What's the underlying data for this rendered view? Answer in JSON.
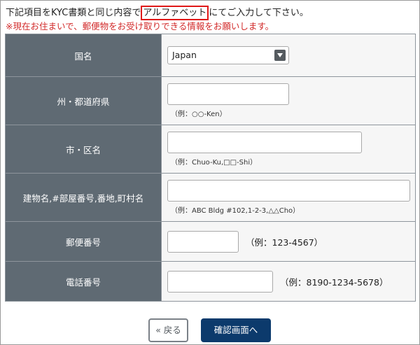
{
  "intro": {
    "line1_before": "下記項目をKYC書類と同じ内容で",
    "line1_highlight": "アルファベット",
    "line1_after": "にてご入力して下さい。",
    "line2": "※現在お住まいで、郵便物をお受け取りできる情報をお願いします。"
  },
  "form": {
    "country": {
      "label": "国名",
      "selected": "Japan"
    },
    "state": {
      "label": "州・都道府県",
      "value": "",
      "hint": "（例：○○-Ken）"
    },
    "city": {
      "label": "市・区名",
      "value": "",
      "hint": "（例：Chuo-Ku,□□-Shi）"
    },
    "address": {
      "label": "建物名,#部屋番号,番地,町村名",
      "value": "",
      "hint": "（例：ABC Bldg #102,1-2-3,△△Cho）"
    },
    "zip": {
      "label": "郵便番号",
      "value": "",
      "hint": "（例：123-4567）"
    },
    "tel": {
      "label": "電話番号",
      "value": "",
      "hint": "（例：8190-1234-5678）"
    }
  },
  "buttons": {
    "back": "« 戻る",
    "next": "確認画面へ"
  },
  "colors": {
    "header_cell": "#5f6a73",
    "highlight_border": "#e01818",
    "notice_text": "#d22a2a",
    "primary_button": "#0c3a6c"
  }
}
